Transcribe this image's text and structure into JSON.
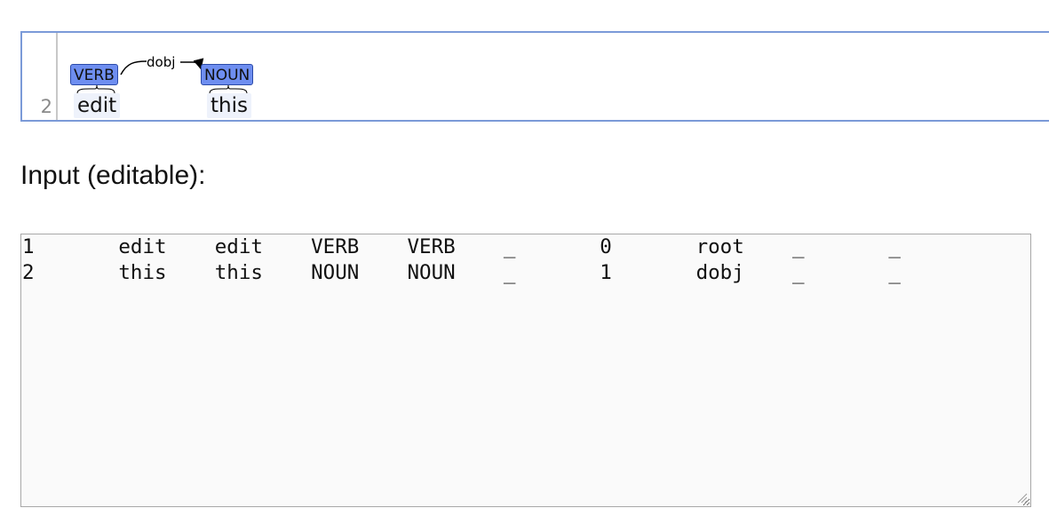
{
  "visualization": {
    "sentence_number": "2",
    "tokens": [
      {
        "form": "edit",
        "tag": "VERB"
      },
      {
        "form": "this",
        "tag": "NOUN"
      }
    ],
    "arcs": [
      {
        "label": "dobj",
        "from": 0,
        "to": 1
      }
    ],
    "colors": {
      "tag_fill": "#6e8ef0",
      "tag_border": "#2b4aa8",
      "frame": "#7b9ad8"
    }
  },
  "input_section": {
    "title": "Input (editable):"
  },
  "editor": {
    "value": "1\tedit\tedit\tVERB\tVERB\t_\t0\troot\t_\t_\n2\tthis\tthis\tNOUN\tNOUN\t_\t1\tdobj\t_\t_"
  }
}
